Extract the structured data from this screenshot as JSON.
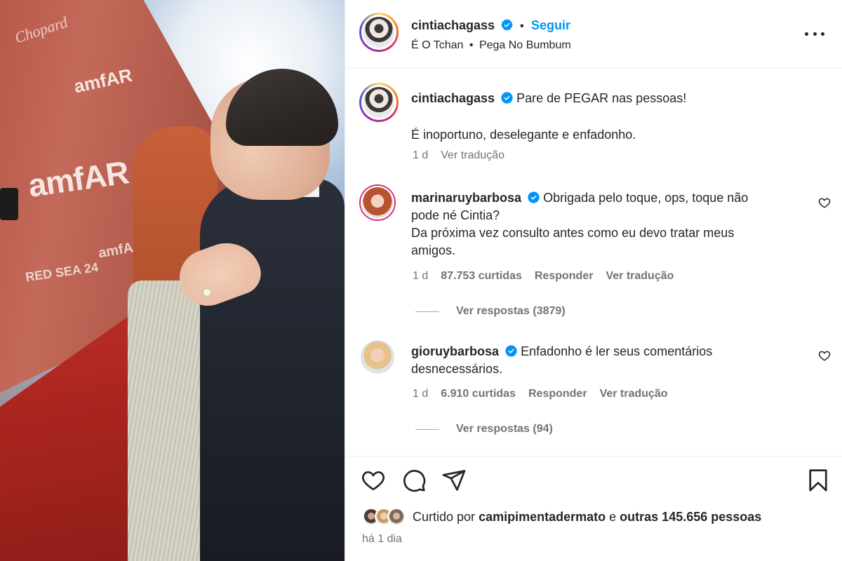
{
  "post": {
    "author": "cintiachagass",
    "follow_label": "Seguir",
    "audio_artist": "É O Tchan",
    "audio_song": "Pega No Bumbum",
    "separator": "•"
  },
  "caption": {
    "username": "cintiachagass",
    "line1": "Pare de PEGAR nas pessoas!",
    "line2": "É inoportuno, deselegante e enfadonho.",
    "time": "1 d",
    "translate": "Ver tradução"
  },
  "comments": [
    {
      "username": "marinaruybarbosa",
      "text_line1": "Obrigada pelo toque, ops, toque não",
      "text_line2": "pode né Cintia?",
      "text_line3": "Da próxima vez consulto antes como eu devo tratar meus",
      "text_line4": "amigos.",
      "time": "1 d",
      "likes": "87.753 curtidas",
      "reply": "Responder",
      "translate": "Ver tradução",
      "view_replies": "Ver respostas (3879)"
    },
    {
      "username": "gioruybarbosa",
      "text_line1": "Enfadonho é ler seus comentários",
      "text_line2": "desnecessários.",
      "time": "1 d",
      "likes": "6.910 curtidas",
      "reply": "Responder",
      "translate": "Ver tradução",
      "view_replies": "Ver respostas (94)"
    }
  ],
  "footer": {
    "liked_prefix": "Curtido por",
    "liked_user": "camipimentadermato",
    "liked_and": "e",
    "liked_others": "outras 145.656 pessoas",
    "posted_ago": "há 1 dia"
  },
  "photo_text": {
    "brand1": "amfAR",
    "brand2": "amfAR",
    "brand3": "amfAR",
    "brand4": "Chopard",
    "brand5": "RED SEA 24"
  },
  "colors": {
    "link": "#0095f6",
    "verified": "#0095f6",
    "muted": "#737373",
    "text": "#262626"
  },
  "icons": [
    "verified-badge-icon",
    "more-options-icon",
    "heart-icon",
    "comment-icon",
    "share-icon",
    "bookmark-icon"
  ]
}
